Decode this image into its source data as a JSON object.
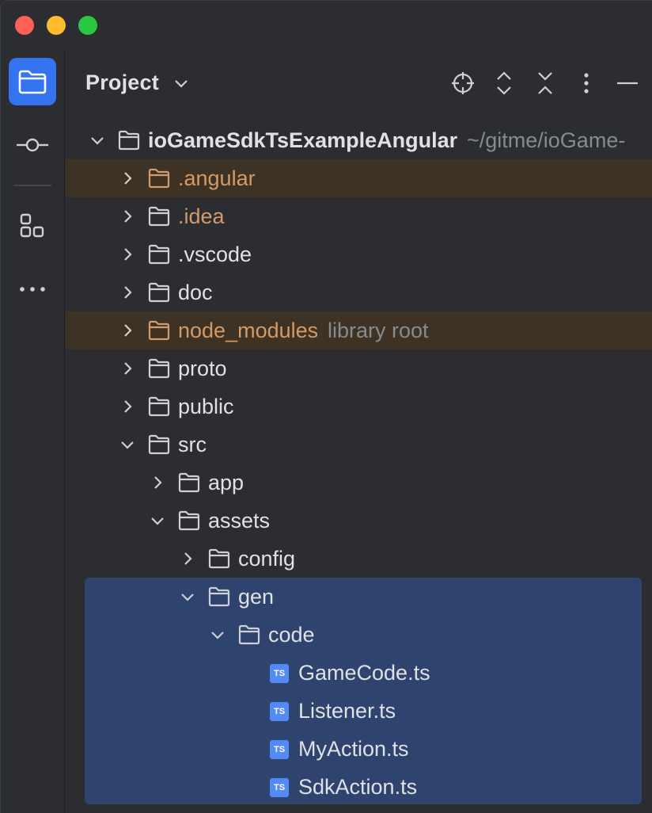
{
  "panel": {
    "title": "Project"
  },
  "sidebar": {
    "items": [
      {
        "name": "project",
        "icon": "folder-icon",
        "active": true
      },
      {
        "name": "commit",
        "icon": "commit-icon",
        "active": false
      },
      {
        "name": "structure",
        "icon": "structure-icon",
        "active": false
      },
      {
        "name": "more",
        "icon": "more-icon",
        "active": false
      }
    ]
  },
  "toolbar": {
    "icons": [
      "locate-icon",
      "expand-all-icon",
      "collapse-all-icon",
      "options-icon",
      "hide-icon"
    ]
  },
  "tree": {
    "root": {
      "label": "ioGameSdkTsExampleAngular",
      "path": "~/gitme/ioGame-"
    },
    "items": [
      {
        "label": ".angular",
        "hint": "",
        "depth": 1,
        "expanded": false,
        "type": "folder",
        "excluded": true
      },
      {
        "label": ".idea",
        "hint": "",
        "depth": 1,
        "expanded": false,
        "type": "folder",
        "excluded": false
      },
      {
        "label": ".vscode",
        "hint": "",
        "depth": 1,
        "expanded": false,
        "type": "folder",
        "excluded": false
      },
      {
        "label": "doc",
        "hint": "",
        "depth": 1,
        "expanded": false,
        "type": "folder",
        "excluded": false
      },
      {
        "label": "node_modules",
        "hint": "library root",
        "depth": 1,
        "expanded": false,
        "type": "folder",
        "excluded": true
      },
      {
        "label": "proto",
        "hint": "",
        "depth": 1,
        "expanded": false,
        "type": "folder",
        "excluded": false
      },
      {
        "label": "public",
        "hint": "",
        "depth": 1,
        "expanded": false,
        "type": "folder",
        "excluded": false
      },
      {
        "label": "src",
        "hint": "",
        "depth": 1,
        "expanded": true,
        "type": "folder",
        "excluded": false
      },
      {
        "label": "app",
        "hint": "",
        "depth": 2,
        "expanded": false,
        "type": "folder",
        "excluded": false
      },
      {
        "label": "assets",
        "hint": "",
        "depth": 2,
        "expanded": true,
        "type": "folder",
        "excluded": false
      },
      {
        "label": "config",
        "hint": "",
        "depth": 3,
        "expanded": false,
        "type": "folder",
        "excluded": false
      },
      {
        "label": "gen",
        "hint": "",
        "depth": 3,
        "expanded": true,
        "type": "folder",
        "excluded": false
      },
      {
        "label": "code",
        "hint": "",
        "depth": 4,
        "expanded": true,
        "type": "folder",
        "excluded": false
      },
      {
        "label": "GameCode.ts",
        "hint": "",
        "depth": 5,
        "type": "ts"
      },
      {
        "label": "Listener.ts",
        "hint": "",
        "depth": 5,
        "type": "ts"
      },
      {
        "label": "MyAction.ts",
        "hint": "",
        "depth": 5,
        "type": "ts"
      },
      {
        "label": "SdkAction.ts",
        "hint": "",
        "depth": 5,
        "type": "ts"
      }
    ]
  },
  "ts_badge": "TS",
  "colors": {
    "background": "#2b2d30",
    "selection": "#2e436e",
    "excluded_row": "#3d3223",
    "orange_text": "#d39a6a",
    "accent": "#3574f0",
    "ts_badge": "#548af7"
  }
}
